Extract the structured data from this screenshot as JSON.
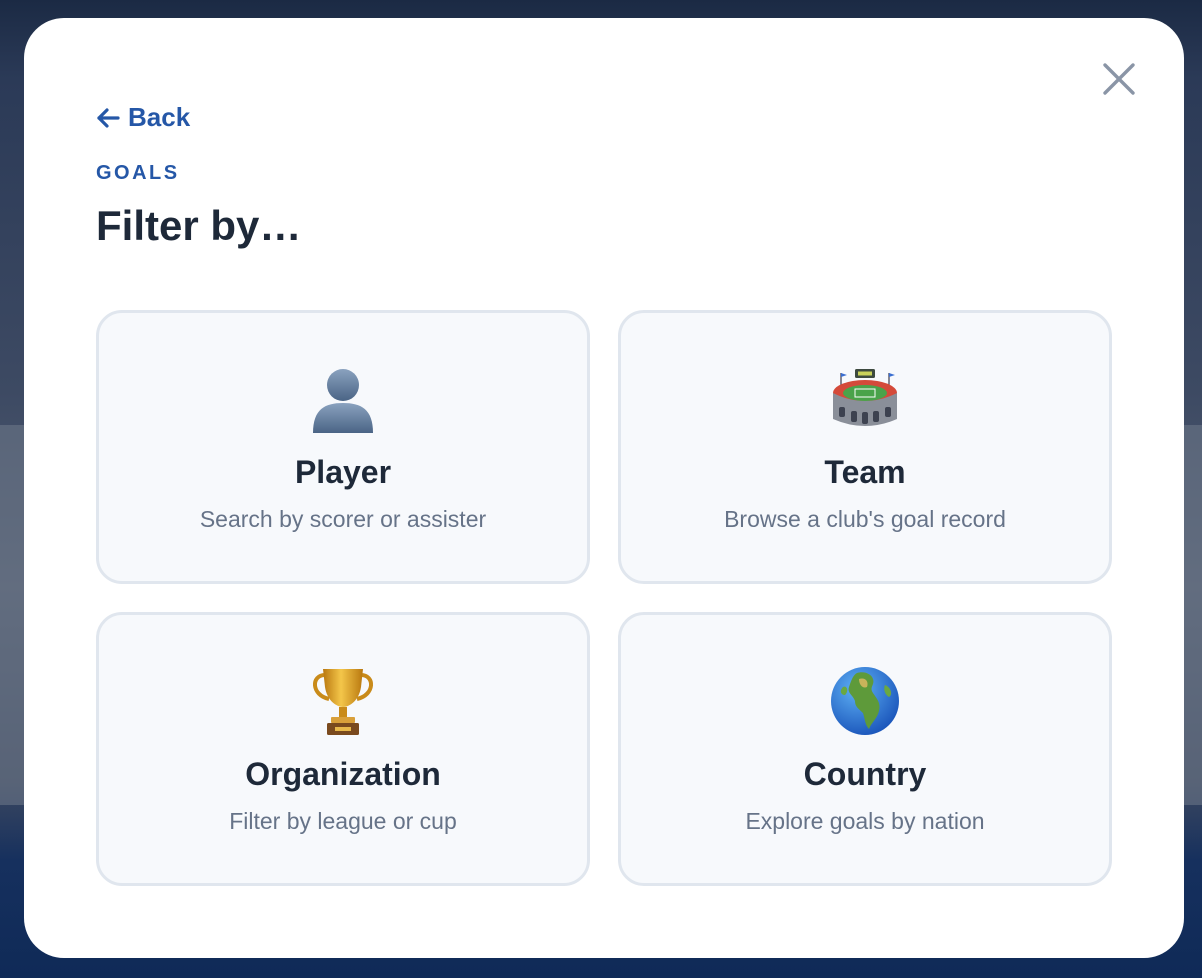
{
  "modal": {
    "back_label": "Back",
    "eyebrow": "GOALS",
    "title": "Filter by…"
  },
  "options": [
    {
      "title": "Player",
      "description": "Search by scorer or assister",
      "icon": "person-silhouette-icon"
    },
    {
      "title": "Team",
      "description": "Browse a club's goal record",
      "icon": "stadium-icon"
    },
    {
      "title": "Organization",
      "description": "Filter by league or cup",
      "icon": "trophy-icon"
    },
    {
      "title": "Country",
      "description": "Explore goals by nation",
      "icon": "globe-icon"
    }
  ],
  "colors": {
    "accent": "#2557a7",
    "heading": "#1e2939",
    "muted": "#667388",
    "card_bg": "#f7f9fc",
    "card_border": "#e0e6ee"
  }
}
